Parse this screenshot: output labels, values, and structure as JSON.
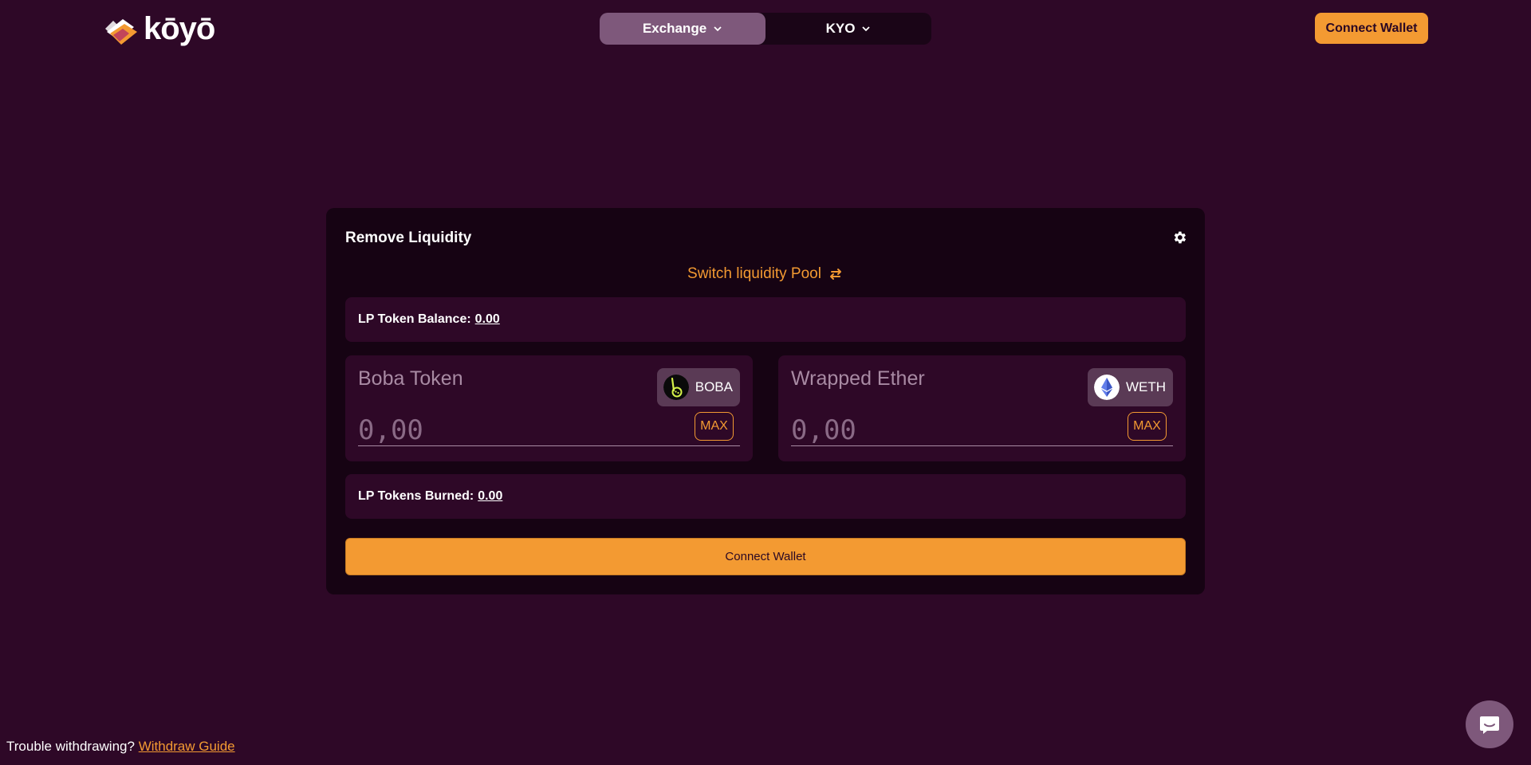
{
  "header": {
    "logo_text": "kōyō",
    "nav": [
      {
        "label": "Exchange",
        "active": true
      },
      {
        "label": "KYO",
        "active": false
      }
    ],
    "connect_label": "Connect Wallet"
  },
  "card": {
    "title": "Remove Liquidity",
    "switch_label": "Switch liquidity Pool",
    "lp_balance_label": "LP Token Balance:",
    "lp_balance_value": "0.00",
    "tokens": [
      {
        "name": "Boba Token",
        "symbol": "BOBA",
        "placeholder": "0,00",
        "max_label": "MAX",
        "icon": "boba-token-icon"
      },
      {
        "name": "Wrapped Ether",
        "symbol": "WETH",
        "placeholder": "0,00",
        "max_label": "MAX",
        "icon": "ethereum-icon"
      }
    ],
    "lp_burned_label": "LP Tokens Burned:",
    "lp_burned_value": "0.00",
    "connect_label": "Connect Wallet"
  },
  "footer": {
    "text": "Trouble withdrawing?",
    "link_label": "Withdraw Guide"
  },
  "colors": {
    "background": "#2e0827",
    "card": "#160313",
    "accent": "#f39a32",
    "nav_active": "#7e587b"
  }
}
